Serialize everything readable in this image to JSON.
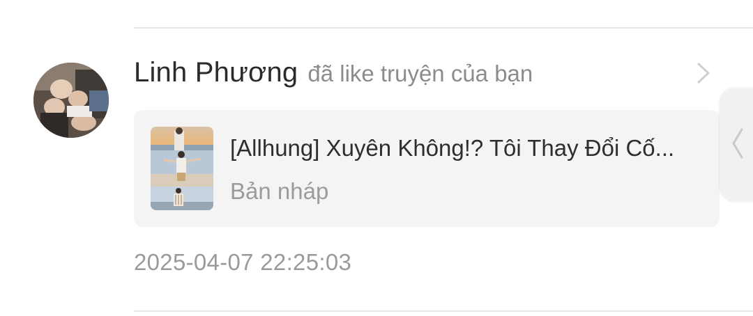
{
  "notification": {
    "user_name": "Linh Phương",
    "action": "đã like truyện của bạn",
    "timestamp": "2025-04-07 22:25:03"
  },
  "story": {
    "title": "[Allhung] Xuyên Không!? Tôi Thay Đổi Cố...",
    "status": "Bản nháp"
  },
  "icons": {
    "open": "chevron-right-icon",
    "side_handle": "chevron-left-icon"
  },
  "colors": {
    "name": "#2b2b2b",
    "secondary_text": "#8c8c8c",
    "card_background": "#f4f4f5",
    "divider": "#e7e7e9"
  }
}
